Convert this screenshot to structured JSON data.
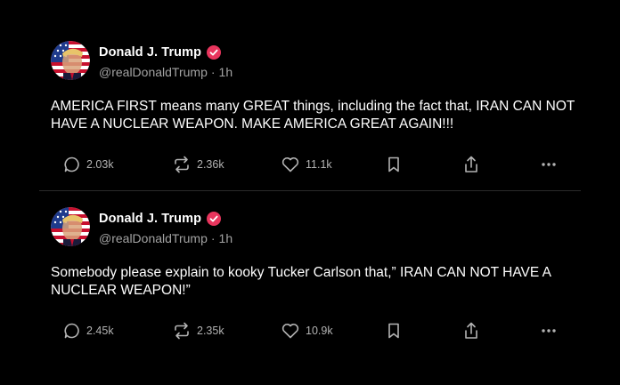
{
  "posts": [
    {
      "author": {
        "display_name": "Donald J. Trump",
        "handle": "@realDonaldTrump",
        "separator": "·",
        "time": "1h",
        "verified_icon": "verified-badge-icon",
        "badge_color": "#e8355d"
      },
      "text": "AMERICA FIRST means many GREAT things, including the fact that, IRAN CAN NOT HAVE A NUCLEAR WEAPON. MAKE AMERICA GREAT AGAIN!!!",
      "actions": {
        "replies": "2.03k",
        "retruths": "2.36k",
        "likes": "11.1k"
      }
    },
    {
      "author": {
        "display_name": "Donald J. Trump",
        "handle": "@realDonaldTrump",
        "separator": "·",
        "time": "1h",
        "verified_icon": "verified-badge-icon",
        "badge_color": "#e8355d"
      },
      "text": "Somebody please explain to kooky Tucker Carlson that,” IRAN CAN NOT HAVE A NUCLEAR WEAPON!”",
      "actions": {
        "replies": "2.45k",
        "retruths": "2.35k",
        "likes": "10.9k"
      }
    }
  ],
  "icons": {
    "reply": "reply-icon",
    "retruth": "retruth-icon",
    "like": "heart-icon",
    "bookmark": "bookmark-icon",
    "share": "share-icon",
    "more": "more-icon"
  },
  "colors": {
    "background": "#000000",
    "text_primary": "#ffffff",
    "text_secondary": "#a3a3a3",
    "divider": "#2a2a2a",
    "verified": "#e8355d"
  }
}
